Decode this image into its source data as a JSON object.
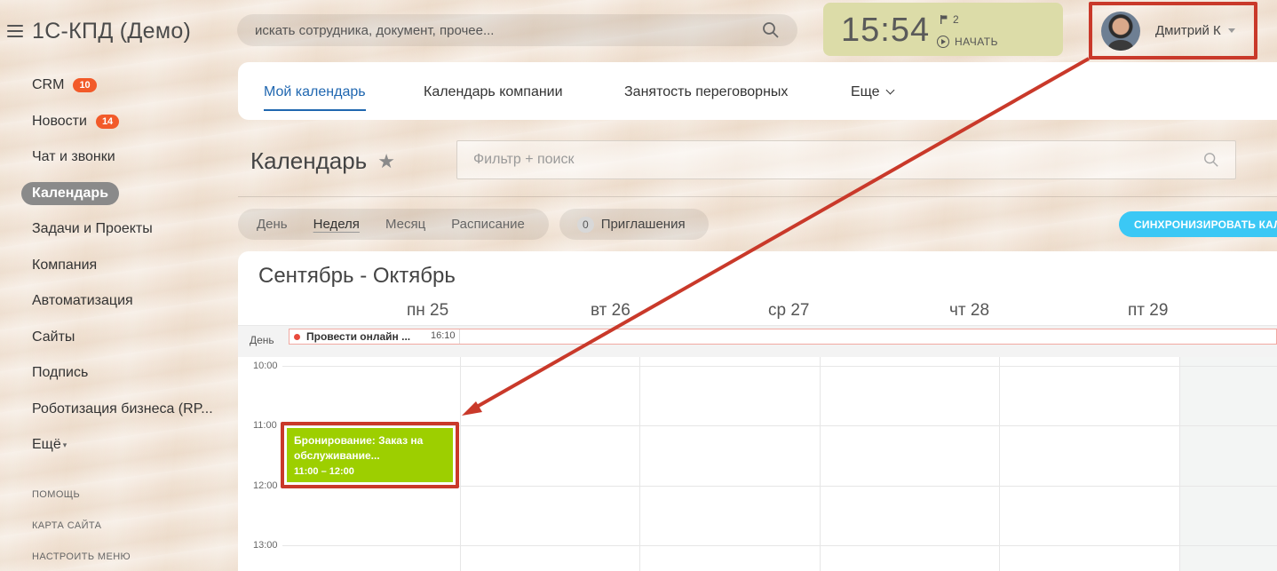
{
  "app": {
    "logo_text": "1С-КПД (Демо)"
  },
  "sidebar": {
    "items": [
      {
        "label": "CRM",
        "badge": "10"
      },
      {
        "label": "Новости",
        "badge": "14"
      },
      {
        "label": "Чат и звонки"
      },
      {
        "label": "Календарь",
        "active": true
      },
      {
        "label": "Задачи и Проекты"
      },
      {
        "label": "Компания"
      },
      {
        "label": "Автоматизация"
      },
      {
        "label": "Сайты"
      },
      {
        "label": "Подпись"
      },
      {
        "label": "Роботизация бизнеса (RP..."
      },
      {
        "label": "Ещё"
      }
    ],
    "small_links": [
      "ПОМОЩЬ",
      "КАРТА САЙТА",
      "НАСТРОИТЬ МЕНЮ"
    ]
  },
  "header": {
    "search_placeholder": "искать сотрудника, документ, прочее...",
    "clock_time": "15:54",
    "flag_count": "2",
    "start_label": "НАЧАТЬ",
    "user_name": "Дмитрий К"
  },
  "tabs": [
    "Мой календарь",
    "Календарь компании",
    "Занятость переговорных",
    "Еще"
  ],
  "page": {
    "title": "Календарь",
    "filter_placeholder": "Фильтр + поиск",
    "views": [
      "День",
      "Неделя",
      "Месяц",
      "Расписание"
    ],
    "active_view": "Неделя",
    "invites_count": "0",
    "invites_label": "Приглашения",
    "sync_label": "СИНХРОНИЗИРОВАТЬ КАЛ"
  },
  "calendar": {
    "range_title": "Сентябрь - Октябрь",
    "days": [
      "пн 25",
      "вт 26",
      "ср 27",
      "чт 28",
      "пт 29"
    ],
    "allday_label": "День",
    "allday_event": {
      "title": "Провести онлайн ...",
      "time": "16:10"
    },
    "hours": [
      "10:00",
      "11:00",
      "12:00",
      "13:00"
    ],
    "event": {
      "title": "Бронирование: Заказ на обслуживание...",
      "time": "11:00 – 12:00",
      "color": "#9dcf00"
    }
  },
  "colors": {
    "accent": "#2067b0",
    "highlight": "#c9392a",
    "badge": "#f25a29",
    "sync": "#3bc8f5"
  }
}
